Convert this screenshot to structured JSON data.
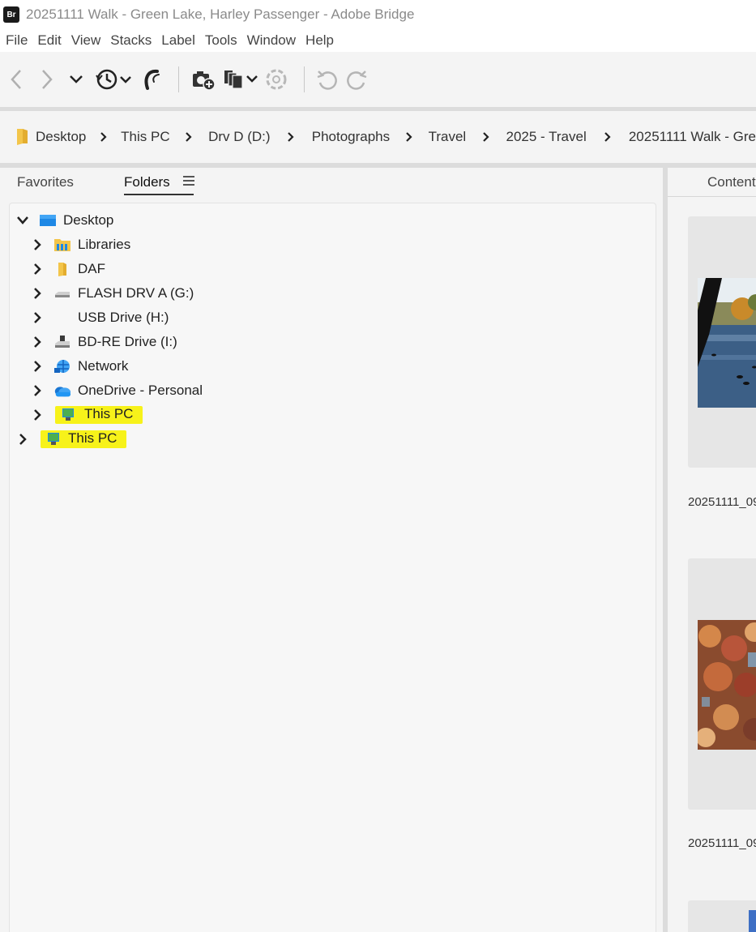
{
  "window": {
    "app_badge": "Br",
    "title": "20251111 Walk - Green Lake, Harley Passenger - Adobe Bridge"
  },
  "menu": [
    "File",
    "Edit",
    "View",
    "Stacks",
    "Label",
    "Tools",
    "Window",
    "Help"
  ],
  "breadcrumb": [
    "Desktop",
    "This PC",
    "Drv D (D:)",
    "Photographs",
    "Travel",
    "2025 - Travel",
    "20251111 Walk - Gre"
  ],
  "left_panel": {
    "tabs": {
      "favorites": "Favorites",
      "folders": "Folders"
    },
    "tree": [
      {
        "label": "Desktop",
        "icon": "desktop-icon",
        "expanded": true
      },
      {
        "label": "Libraries",
        "icon": "libraries-icon"
      },
      {
        "label": "DAF",
        "icon": "folder-icon"
      },
      {
        "label": "FLASH DRV A (G:)",
        "icon": "drive-icon"
      },
      {
        "label": "USB Drive (H:)",
        "icon": ""
      },
      {
        "label": "BD-RE Drive (I:)",
        "icon": "optical-drive-icon"
      },
      {
        "label": "Network",
        "icon": "network-icon"
      },
      {
        "label": "OneDrive - Personal",
        "icon": "onedrive-icon"
      },
      {
        "label": "This PC",
        "icon": "this-pc-icon",
        "highlighted": true
      },
      {
        "label": "This PC",
        "icon": "this-pc-icon",
        "highlighted": true
      }
    ]
  },
  "content_panel": {
    "tab": "Content",
    "items": [
      {
        "label": "20251111_09"
      },
      {
        "label": "20251111_09"
      }
    ]
  },
  "colors": {
    "highlight": "#f7f21a",
    "desktop_blue": "#1e88e5",
    "onedrive_blue": "#1976d2"
  }
}
